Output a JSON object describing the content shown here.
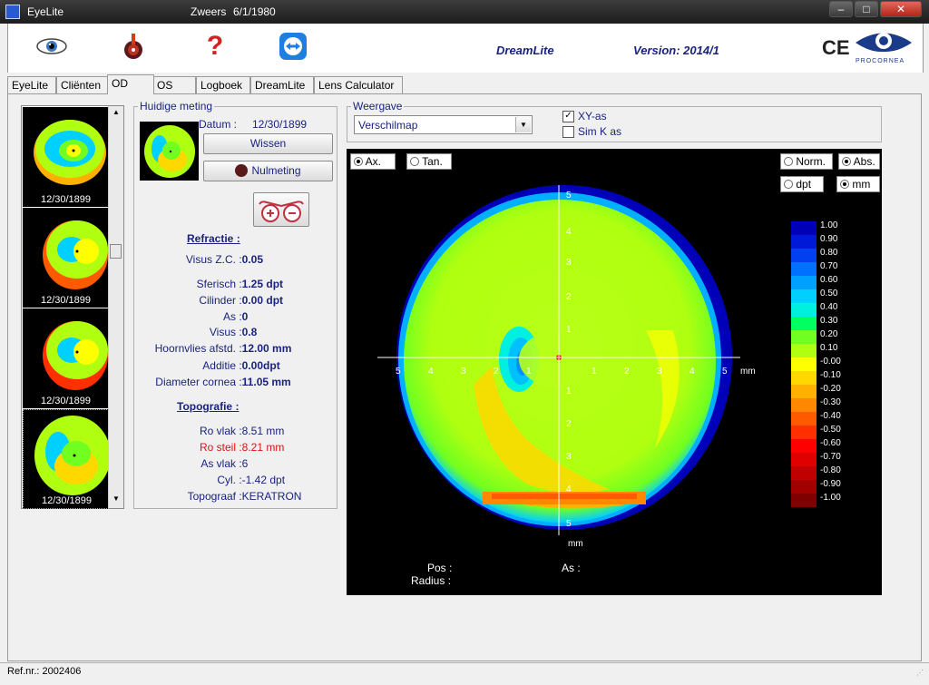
{
  "window": {
    "app_title": "EyeLite",
    "patient": "Zweers",
    "dob": "6/1/1980",
    "min": "–",
    "max": "□",
    "close": "✕"
  },
  "toolbar": {
    "product": "DreamLite",
    "version": "Version: 2014/1",
    "ce": "CE",
    "logo_text": "PROCORNEA",
    "help": "?"
  },
  "tabs": [
    "EyeLite",
    "Cliënten",
    "OD",
    "OS",
    "Logboek",
    "DreamLite",
    "Lens Calculator"
  ],
  "thumbs": [
    "12/30/1899",
    "12/30/1899",
    "12/30/1899",
    "12/30/1899"
  ],
  "measurement": {
    "group_label": "Huidige meting",
    "datum_label": "Datum :",
    "datum_value": "12/30/1899",
    "wissen": "Wissen",
    "nulmeting": "Nulmeting"
  },
  "refractie": {
    "heading": "Refractie :",
    "rows": [
      {
        "label": "Visus Z.C.",
        "value": "0.05"
      },
      {
        "label": "Sferisch",
        "value": "1.25 dpt"
      },
      {
        "label": "Cilinder",
        "value": "0.00 dpt"
      },
      {
        "label": "As",
        "value": "0"
      },
      {
        "label": "Visus",
        "value": "0.8"
      },
      {
        "label": "Hoornvlies afstd.",
        "value": "12.00 mm"
      },
      {
        "label": "Additie",
        "value": "0.00dpt"
      },
      {
        "label": "Diameter cornea",
        "value": "11.05 mm"
      }
    ]
  },
  "topografie": {
    "heading": "Topografie :",
    "rows": [
      {
        "label": "Ro vlak",
        "value": "8.51 mm",
        "color": "#1a237e"
      },
      {
        "label": "Ro steil",
        "value": "8.21 mm",
        "color": "#e01010"
      },
      {
        "label": "As vlak",
        "value": "6",
        "color": "#1a237e"
      },
      {
        "label": "Cyl.",
        "value": "-1.42 dpt",
        "color": "#1a237e"
      },
      {
        "label": "Topograaf",
        "value": "KERATRON",
        "color": "#1a237e"
      }
    ]
  },
  "weergave": {
    "label": "Weergave",
    "select_value": "Verschilmap",
    "xy_as": "XY-as",
    "sim_k": "Sim K as",
    "xy_checked": true,
    "simk_checked": false
  },
  "map": {
    "ax": "Ax.",
    "tan": "Tan.",
    "norm": "Norm.",
    "abs": "Abs.",
    "dpt": "dpt",
    "mm": "mm",
    "unit": "mm",
    "scale": [
      "1.00",
      "0.90",
      "0.80",
      "0.70",
      "0.60",
      "0.50",
      "0.40",
      "0.30",
      "0.20",
      "0.10",
      "-0.00",
      "-0.10",
      "-0.20",
      "-0.30",
      "-0.40",
      "-0.50",
      "-0.60",
      "-0.70",
      "-0.80",
      "-0.90",
      "-1.00"
    ],
    "scale_colors": [
      "#0000b8",
      "#0018d8",
      "#0040f0",
      "#0070ff",
      "#00a0ff",
      "#00d0ff",
      "#00f0e0",
      "#00ff60",
      "#70ff20",
      "#b0ff10",
      "#ffff00",
      "#ffd800",
      "#ffb000",
      "#ff8800",
      "#ff5a00",
      "#ff3000",
      "#ff0000",
      "#e00000",
      "#c00000",
      "#a00000",
      "#800000"
    ],
    "x_ticks": [
      "5",
      "4",
      "3",
      "2",
      "1",
      "1",
      "2",
      "3",
      "4",
      "5"
    ],
    "y_ticks_top": [
      "5",
      "4",
      "3",
      "2",
      "1"
    ],
    "y_ticks_bottom": [
      "1",
      "2",
      "3",
      "4",
      "5"
    ]
  },
  "footer": {
    "pos": "Pos :",
    "radius": "Radius :",
    "as": "As :"
  },
  "status": {
    "ref": "Ref.nr.: 2002406"
  }
}
